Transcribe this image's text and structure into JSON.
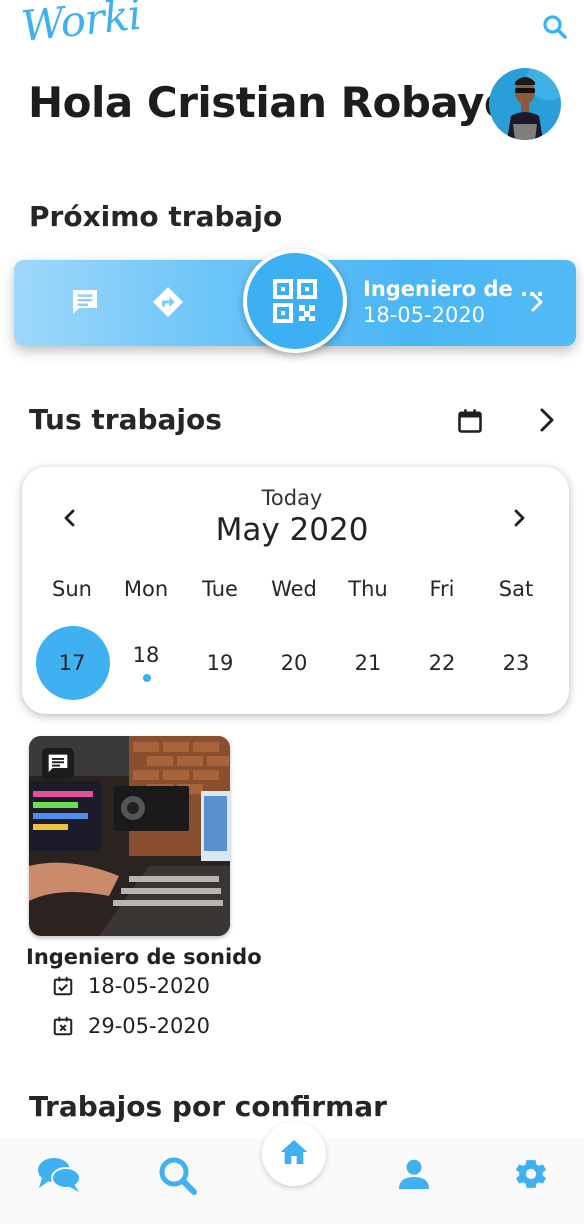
{
  "app": {
    "logo": "Worki"
  },
  "header": {
    "greeting": "Hola Cristian Robayo"
  },
  "next_job": {
    "section_title": "Próximo trabajo",
    "title": "Ingeniero de ...",
    "date": "18-05-2020"
  },
  "jobs": {
    "section_title": "Tus trabajos"
  },
  "calendar": {
    "today_label": "Today",
    "month_label": "May 2020",
    "weekdays": [
      "Sun",
      "Mon",
      "Tue",
      "Wed",
      "Thu",
      "Fri",
      "Sat"
    ],
    "days": [
      "17",
      "18",
      "19",
      "20",
      "21",
      "22",
      "23"
    ],
    "selected_day": "17",
    "event_day": "18"
  },
  "job_card": {
    "name": "Ingeniero de sonido",
    "start_date": "18-05-2020",
    "end_date": "29-05-2020"
  },
  "pending": {
    "section_title": "Trabajos por confirmar"
  },
  "nav": {
    "items": [
      "chat-icon",
      "search-icon",
      "home-icon",
      "profile-icon",
      "settings-icon"
    ]
  },
  "colors": {
    "accent": "#3fb1f2",
    "text": "#1f1f1f"
  }
}
